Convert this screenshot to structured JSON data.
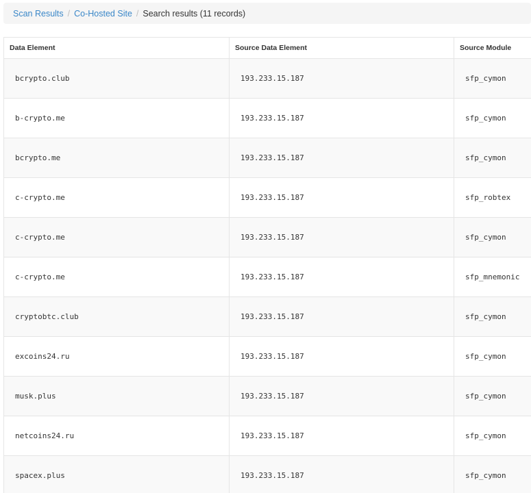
{
  "breadcrumb": {
    "items": [
      {
        "label": "Scan Results"
      },
      {
        "label": "Co-Hosted Site"
      }
    ],
    "separator": "/",
    "current": "Search results (11 records)"
  },
  "table": {
    "headers": [
      "Data Element",
      "Source Data Element",
      "Source Module"
    ],
    "rows": [
      [
        "bcrypto.club",
        "193.233.15.187",
        "sfp_cymon"
      ],
      [
        "b-crypto.me",
        "193.233.15.187",
        "sfp_cymon"
      ],
      [
        "bcrypto.me",
        "193.233.15.187",
        "sfp_cymon"
      ],
      [
        "c-crypto.me",
        "193.233.15.187",
        "sfp_robtex"
      ],
      [
        "c-crypto.me",
        "193.233.15.187",
        "sfp_cymon"
      ],
      [
        "c-crypto.me",
        "193.233.15.187",
        "sfp_mnemonic"
      ],
      [
        "cryptobtc.club",
        "193.233.15.187",
        "sfp_cymon"
      ],
      [
        "excoins24.ru",
        "193.233.15.187",
        "sfp_cymon"
      ],
      [
        "musk.plus",
        "193.233.15.187",
        "sfp_cymon"
      ],
      [
        "netcoins24.ru",
        "193.233.15.187",
        "sfp_cymon"
      ],
      [
        "spacex.plus",
        "193.233.15.187",
        "sfp_cymon"
      ]
    ]
  },
  "colors": {
    "link": "#3a87c8",
    "breadcrumb_bg": "#f5f5f5",
    "row_stripe": "#f9f9f9",
    "border": "#e5e5e5"
  }
}
